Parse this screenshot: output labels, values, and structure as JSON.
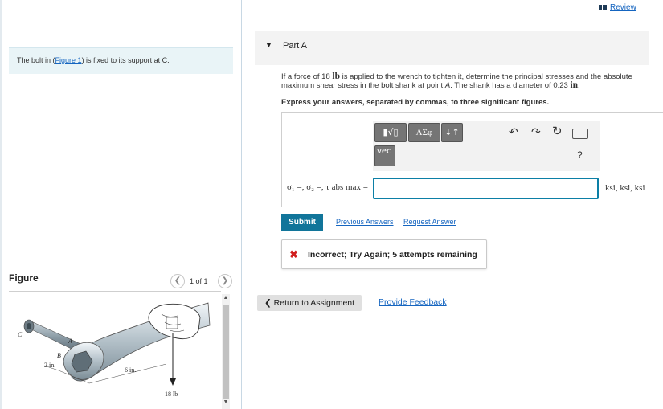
{
  "header": {
    "review_label": "Review"
  },
  "left": {
    "intro": {
      "before": "The bolt in (",
      "link": "Figure 1",
      "after": ") is fixed to its support at C."
    },
    "figure": {
      "title": "Figure",
      "counter": "1 of 1",
      "labels": {
        "C": "C",
        "A": "A",
        "B": "B",
        "dim1": "2 in.",
        "dim2": "6 in.",
        "force": "18 lb"
      }
    }
  },
  "part": {
    "label": "Part A",
    "question": {
      "p1": "If a force of 18 ",
      "unit_lb": "lb",
      "p2": " is applied to the wrench to tighten it, determine the principal stresses and the absolute maximum shear stress in the bolt shank at point ",
      "point": "A",
      "p3": ". The shank has a diameter of 0.23 ",
      "unit_in": "in",
      "p4": "."
    },
    "instruction": "Express your answers, separated by commas, to three significant figures.",
    "toolbar": {
      "template_label": "▮√▯",
      "greek_label": "ΑΣφ",
      "arrows_label": "↓↑",
      "vec_label": "vec",
      "help_label": "?"
    },
    "answer_label": "σ₁ =, σ₂ =, τ abs max =",
    "answer_value": "",
    "units": "ksi, ksi, ksi",
    "submit_label": "Submit",
    "previous_answers_label": "Previous Answers",
    "request_answer_label": "Request Answer",
    "feedback": {
      "status": "incorrect",
      "text": "Incorrect; Try Again; 5 attempts remaining"
    }
  },
  "footer": {
    "return_label": "Return to Assignment",
    "feedback_label": "Provide Feedback"
  },
  "colors": {
    "accent": "#11759a",
    "link": "#1565c0",
    "error": "#d11f1f",
    "intro_bg": "#e9f4f7"
  }
}
